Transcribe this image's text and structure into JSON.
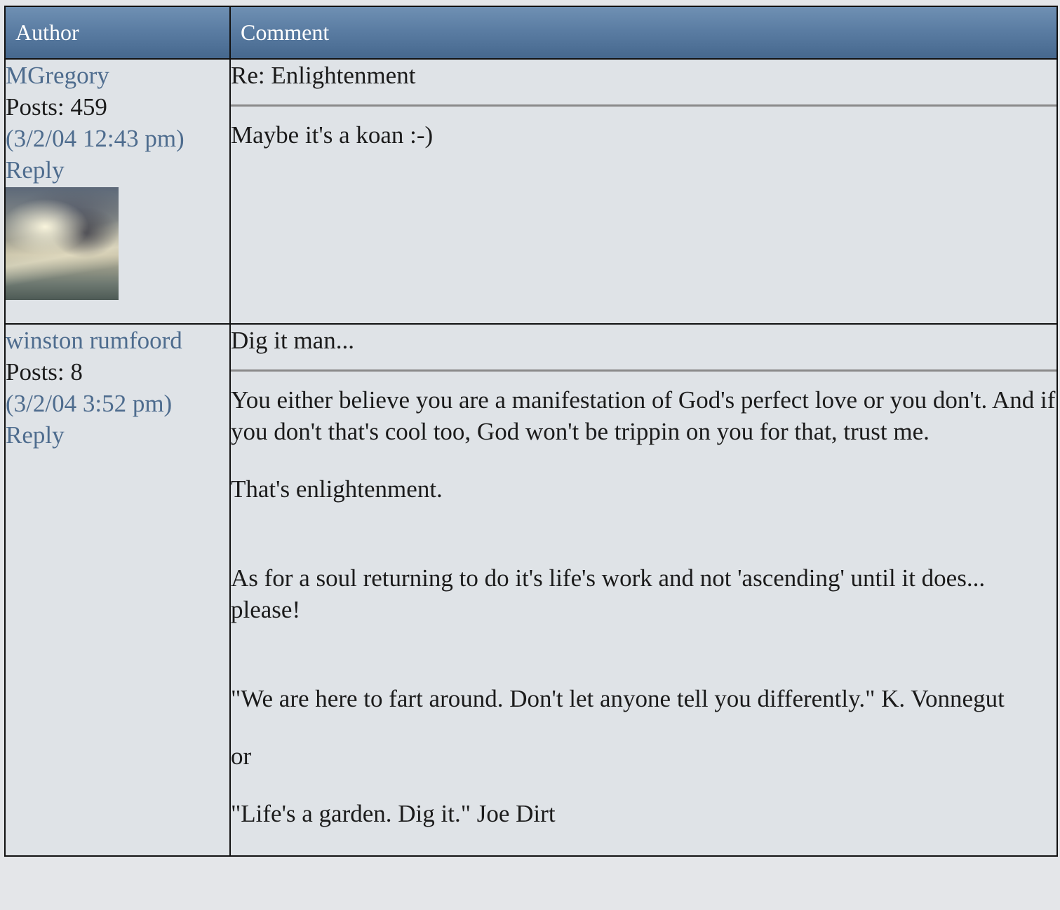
{
  "header": {
    "author_label": "Author",
    "comment_label": "Comment"
  },
  "posts": [
    {
      "author": "MGregory",
      "posts_count": "Posts: 459",
      "timestamp": "(3/2/04 12:43 pm)",
      "reply_label": "Reply",
      "has_avatar": true,
      "subject": "Re: Enlightenment",
      "body": [
        "Maybe it's a koan :-)"
      ]
    },
    {
      "author": "winston rumfoord",
      "posts_count": "Posts: 8",
      "timestamp": "(3/2/04 3:52 pm)",
      "reply_label": "Reply",
      "has_avatar": false,
      "subject": "Dig it man...",
      "body": [
        "You either believe you are a manifestation of God's perfect love or you don't. And if you don't that's cool too, God won't be trippin on you for that, trust me.",
        "That's enlightenment.",
        "As for a soul returning to do it's life's work and not 'ascending' until it does... please!",
        "\"We are here to fart around. Don't let anyone tell you differently.\" K. Vonnegut",
        "or",
        "\"Life's a garden. Dig it.\" Joe Dirt"
      ]
    }
  ]
}
